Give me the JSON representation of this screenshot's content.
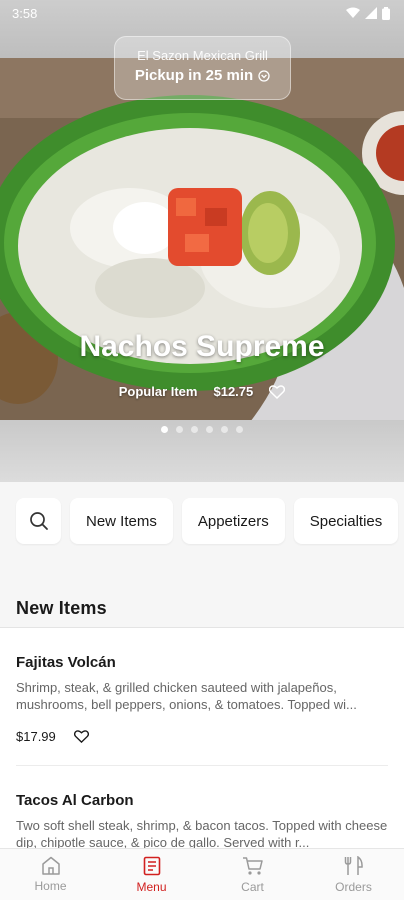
{
  "status_bar": {
    "time": "3:58"
  },
  "restaurant": {
    "name": "El Sazon Mexican Grill",
    "pickup_text": "Pickup in 25 min"
  },
  "featured": {
    "title": "Nachos Supreme",
    "tag": "Popular Item",
    "price": "$12.75",
    "slides": 6,
    "active_slide": 0
  },
  "categories": [
    "New Items",
    "Appetizers",
    "Specialties"
  ],
  "section": {
    "title": "New Items"
  },
  "items": [
    {
      "name": "Fajitas Volcán",
      "description": "Shrimp, steak, & grilled chicken sauteed with jalapeños, mushrooms, bell peppers, onions, & tomatoes. Topped wi...",
      "price": "$17.99"
    },
    {
      "name": "Tacos Al Carbon",
      "description": "Two soft shell steak, shrimp, & bacon tacos. Topped with cheese dip, chipotle sauce, & pico de gallo. Served with r...",
      "price": ""
    }
  ],
  "tabs": [
    {
      "label": "Home",
      "icon": "home-icon",
      "active": false
    },
    {
      "label": "Menu",
      "icon": "menu-icon",
      "active": true
    },
    {
      "label": "Cart",
      "icon": "cart-icon",
      "active": false
    },
    {
      "label": "Orders",
      "icon": "orders-icon",
      "active": false
    }
  ],
  "colors": {
    "accent": "#d1201f",
    "inactive": "#9a9a9a"
  }
}
